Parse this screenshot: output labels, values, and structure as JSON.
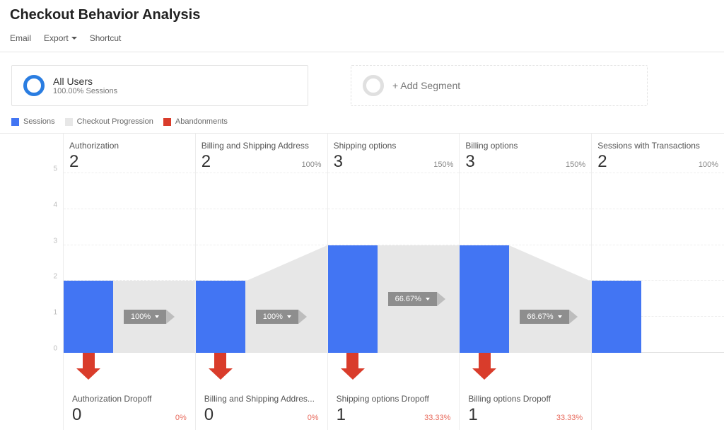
{
  "page": {
    "title": "Checkout Behavior Analysis"
  },
  "toolbar": {
    "email": "Email",
    "export": "Export",
    "shortcut": "Shortcut"
  },
  "segments": {
    "all_users": {
      "title": "All Users",
      "sub": "100.00% Sessions"
    },
    "add": {
      "title": "+ Add Segment"
    }
  },
  "legend": {
    "sessions": "Sessions",
    "progression": "Checkout Progression",
    "abandonments": "Abandonments"
  },
  "colors": {
    "sessions": "#4275f3",
    "progression": "#e7e7e7",
    "abandon": "#d93c2b",
    "pill": "#8e8e8e",
    "arrowhead": "#bdbdbd",
    "red_text": "#e86a5c"
  },
  "chart_data": {
    "type": "funnel",
    "y_axis": {
      "min": 0,
      "max": 5,
      "ticks": [
        0,
        1,
        2,
        3,
        4,
        5
      ]
    },
    "steps": [
      {
        "label": "Authorization",
        "sessions": 2,
        "pct_of_prev": null,
        "progression_pct": "100%",
        "dropoff_label": "Authorization Dropoff",
        "dropoff": 0,
        "dropoff_pct": "0%"
      },
      {
        "label": "Billing and Shipping Address",
        "sessions": 2,
        "pct_of_prev": "100%",
        "progression_pct": "100%",
        "dropoff_label": "Billing and Shipping Addres...",
        "dropoff": 0,
        "dropoff_pct": "0%"
      },
      {
        "label": "Shipping options",
        "sessions": 3,
        "pct_of_prev": "150%",
        "progression_pct": "66.67%",
        "dropoff_label": "Shipping options Dropoff",
        "dropoff": 1,
        "dropoff_pct": "33.33%"
      },
      {
        "label": "Billing options",
        "sessions": 3,
        "pct_of_prev": "150%",
        "progression_pct": "66.67%",
        "dropoff_label": "Billing options Dropoff",
        "dropoff": 1,
        "dropoff_pct": "33.33%"
      },
      {
        "label": "Sessions with Transactions",
        "sessions": 2,
        "pct_of_prev": "100%",
        "progression_pct": null,
        "dropoff_label": null,
        "dropoff": null,
        "dropoff_pct": null
      }
    ]
  }
}
